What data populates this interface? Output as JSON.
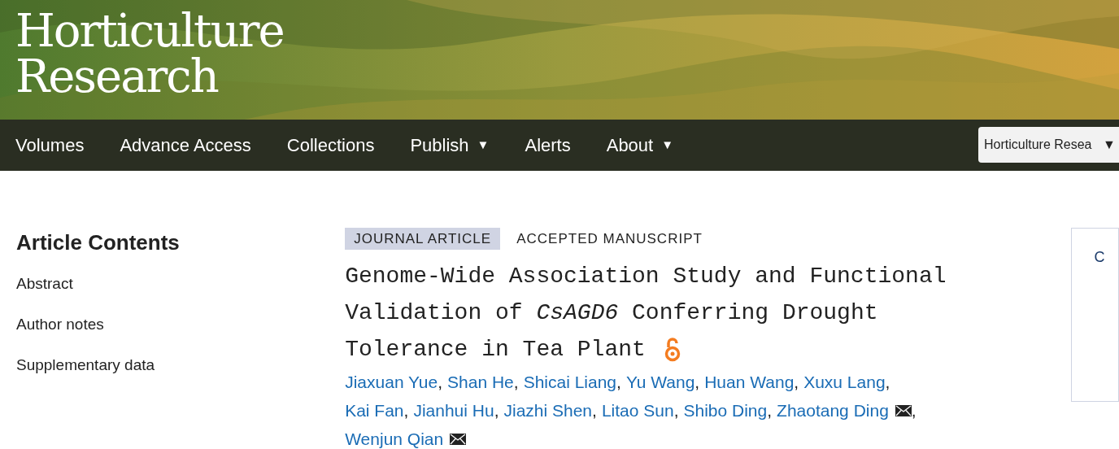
{
  "site_title": [
    "Horticulture",
    "Research"
  ],
  "nav": [
    {
      "label": "Volumes"
    },
    {
      "label": "Advance Access"
    },
    {
      "label": "Collections"
    },
    {
      "label": "Publish",
      "caret": "▼"
    },
    {
      "label": "Alerts"
    },
    {
      "label": "About",
      "caret": "▼"
    }
  ],
  "journal_select": {
    "value": "Horticulture Resea",
    "caret": "▼"
  },
  "sidebar": {
    "title": "Article Contents",
    "items": [
      "Abstract",
      "Author notes",
      "Supplementary data"
    ]
  },
  "article": {
    "tags": [
      {
        "label": "JOURNAL ARTICLE",
        "kind": "filled"
      },
      {
        "label": "ACCEPTED MANUSCRIPT",
        "kind": "plain"
      }
    ],
    "title_lines": [
      "Genome-Wide Association Study and Functional",
      "Validation of *CsAGD6* Conferring Drought",
      "Tolerance in Tea Plant"
    ],
    "open_access": true,
    "author_lines": [
      [
        {
          "name": "Jiaxuan Yue",
          "corresponding": false,
          "suffix": ","
        },
        {
          "name": "Shan He",
          "corresponding": false,
          "suffix": ","
        },
        {
          "name": "Shicai Liang",
          "corresponding": false,
          "suffix": ","
        },
        {
          "name": "Yu Wang",
          "corresponding": false,
          "suffix": ","
        },
        {
          "name": "Huan Wang",
          "corresponding": false,
          "suffix": ","
        },
        {
          "name": "Xuxu Lang",
          "corresponding": false,
          "suffix": ","
        }
      ],
      [
        {
          "name": "Kai Fan",
          "corresponding": false,
          "suffix": ","
        },
        {
          "name": "Jianhui Hu",
          "corresponding": false,
          "suffix": ","
        },
        {
          "name": "Jiazhi Shen",
          "corresponding": false,
          "suffix": ","
        },
        {
          "name": "Litao Sun",
          "corresponding": false,
          "suffix": ","
        },
        {
          "name": "Shibo Ding",
          "corresponding": false,
          "suffix": ","
        },
        {
          "name": "Zhaotang Ding",
          "corresponding": true,
          "suffix": ","
        }
      ],
      [
        {
          "name": "Wenjun Qian",
          "corresponding": true
        }
      ]
    ]
  },
  "side_panel": {
    "text": "C"
  }
}
